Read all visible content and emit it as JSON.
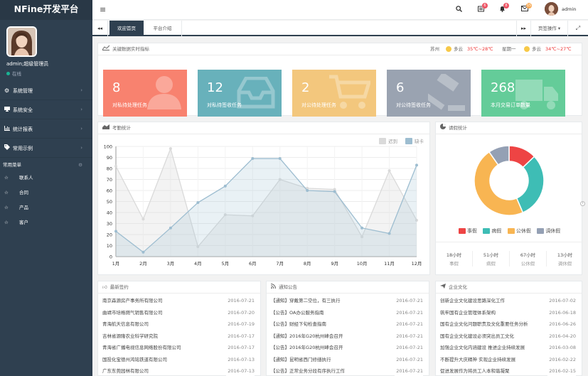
{
  "app": {
    "title": "NFine开发平台"
  },
  "profile": {
    "name": "admin;超级管理员",
    "status": "在线"
  },
  "sidebar": {
    "menus": [
      {
        "label": "系统管理",
        "icon": "gears-icon"
      },
      {
        "label": "系统安全",
        "icon": "desktop-icon"
      },
      {
        "label": "统计报表",
        "icon": "bar-chart-icon"
      },
      {
        "label": "常用示例",
        "icon": "tag-icon"
      }
    ],
    "common_heading": "常用菜单",
    "common": [
      {
        "label": "联系人"
      },
      {
        "label": "合同"
      },
      {
        "label": "产品"
      },
      {
        "label": "客户"
      }
    ]
  },
  "topbar": {
    "badges": [
      "6",
      "8",
      "15"
    ],
    "user": "admin"
  },
  "tabs": {
    "items": [
      "欢迎首页",
      "平台介绍"
    ],
    "active": "欢迎首页",
    "ops": "页签操作 ▾"
  },
  "metrics": {
    "title": "关键数据实时指标",
    "weather": {
      "city": "苏州",
      "today_text": "多云",
      "today_temp": "35℃~28℃",
      "weekday": "星期一",
      "tomorrow_text": "多云",
      "tomorrow_temp": "34℃~27℃"
    },
    "cards": [
      {
        "value": "8",
        "label": "对私待处理任务",
        "color": "#f8826f",
        "icon": "user-icon"
      },
      {
        "value": "12",
        "label": "对私待签收任务",
        "color": "#68b1bb",
        "icon": "inbox-icon"
      },
      {
        "value": "2",
        "label": "对公待处理任务",
        "color": "#f3c77d",
        "icon": "cart-icon"
      },
      {
        "value": "6",
        "label": "对公待签收任务",
        "color": "#9aa3b1",
        "icon": "gavel-icon"
      },
      {
        "value": "268",
        "label": "本月交易订单数量",
        "color": "#64cc99",
        "icon": "truck-icon"
      }
    ]
  },
  "attendance": {
    "title": "考勤统计",
    "legend": [
      "迟到",
      "缺卡"
    ]
  },
  "chart_data": [
    {
      "type": "area",
      "categories": [
        "1月",
        "2月",
        "3月",
        "4月",
        "5月",
        "6月",
        "7月",
        "8月",
        "9月",
        "10月",
        "11月",
        "12月"
      ],
      "series": [
        {
          "name": "迟到",
          "values": [
            82,
            34,
            98,
            9,
            38,
            37,
            70,
            62,
            61,
            18,
            78,
            33
          ],
          "color": "#dadada"
        },
        {
          "name": "缺卡",
          "values": [
            23,
            4,
            26,
            49,
            64,
            89,
            89,
            60,
            59,
            26,
            21,
            83
          ],
          "color": "#9dbdd0"
        }
      ],
      "ylim": [
        0,
        100
      ],
      "yticks": [
        0,
        10,
        20,
        30,
        40,
        50,
        60,
        70,
        80,
        90,
        100
      ],
      "grid": true,
      "legend": "top-right"
    },
    {
      "type": "pie",
      "categories": [
        "事假",
        "病假",
        "公休假",
        "调休假"
      ],
      "values": [
        8,
        19,
        29,
        6
      ],
      "colors": [
        "#ee4444",
        "#3ebdb5",
        "#f8b552",
        "#94a0b4"
      ]
    }
  ],
  "leave": {
    "title": "请假统计",
    "legend": [
      "事假",
      "病假",
      "公休假",
      "调休假"
    ],
    "stats": [
      {
        "value": "18小时",
        "label": "事假"
      },
      {
        "value": "51小时",
        "label": "病假"
      },
      {
        "value": "67小时",
        "label": "公休假"
      },
      {
        "value": "13小时",
        "label": "调休假"
      }
    ]
  },
  "customers": {
    "title": "最新签约",
    "rows": [
      {
        "name": "南京森源房产事务所有限公司",
        "date": "2016-07-21"
      },
      {
        "name": "曲靖市培格燃气销售有限公司",
        "date": "2016-07-20"
      },
      {
        "name": "青海航天信息有限公司",
        "date": "2016-07-19"
      },
      {
        "name": "吉林省源隆农业科学研究院",
        "date": "2016-07-17"
      },
      {
        "name": "青海省广播电视信息网络股份有限公司",
        "date": "2016-07-17"
      },
      {
        "name": "国投化宝德州鸿铭铁道有限公司",
        "date": "2016-07-13"
      },
      {
        "name": "广东东莞园林有限公司",
        "date": "2016-07-13"
      }
    ]
  },
  "notices": {
    "title": "通知公告",
    "rows": [
      {
        "text": "【通知】穿戴第二空位，有三执行",
        "date": "2016-07-21"
      },
      {
        "text": "【公告】OA办公服务指南",
        "date": "2016-07-21"
      },
      {
        "text": "【公告】财经下旬检查指南",
        "date": "2016-07-21"
      },
      {
        "text": "【通知】2016年G20杭州峰会召开",
        "date": "2016-07-21"
      },
      {
        "text": "【公告】2016年G20杭州峰会召开",
        "date": "2016-07-21"
      },
      {
        "text": "【通知】昆明省西门修缮执行",
        "date": "2016-07-21"
      },
      {
        "text": "【公告】正常业务分段有序执行工作",
        "date": "2016-07-21"
      }
    ]
  },
  "culture": {
    "title": "企业文化",
    "rows": [
      {
        "text": "创新企业文化建设思路深化工作",
        "date": "2016-07-02"
      },
      {
        "text": "筑牢国有企业管理体系架构",
        "date": "2016-06-18"
      },
      {
        "text": "国有企业文化问题职责及文化重要任务分析",
        "date": "2016-06-26"
      },
      {
        "text": "国有企业文化建设必须突出员工文化",
        "date": "2016-04-20"
      },
      {
        "text": "加强企业文化内涵建设 推进企业持续发展",
        "date": "2016-03-08"
      },
      {
        "text": "不断提升大庆精神 实现企业持续发展",
        "date": "2016-02-22"
      },
      {
        "text": "促进发展作为将员工人本和谐凝聚",
        "date": "2016-02-15"
      }
    ]
  }
}
